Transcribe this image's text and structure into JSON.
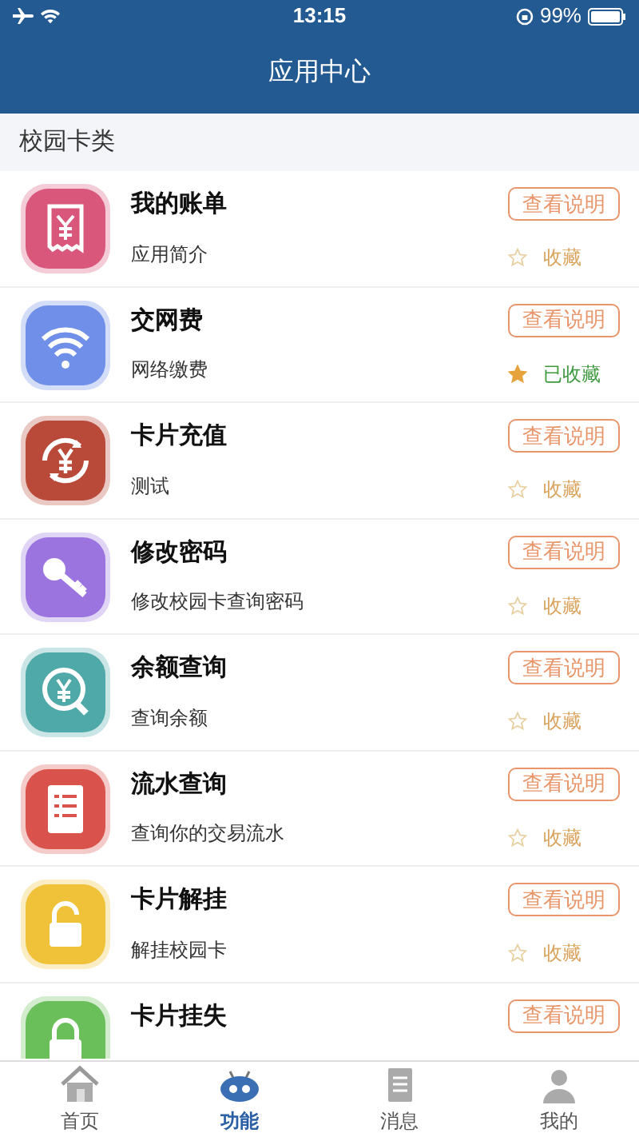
{
  "status_bar": {
    "time": "13:15",
    "battery": "99%"
  },
  "nav_bar": {
    "title": "应用中心"
  },
  "section": {
    "title": "校园卡类"
  },
  "apps": [
    {
      "title": "我的账单",
      "subtitle": "应用简介",
      "button": "查看说明",
      "favorite": {
        "label": "收藏",
        "favorited": false
      },
      "color": "#d9577a"
    },
    {
      "title": "交网费",
      "subtitle": "网络缴费",
      "button": "查看说明",
      "favorite": {
        "label": "已收藏",
        "favorited": true
      },
      "color": "#6f8fe8"
    },
    {
      "title": "卡片充值",
      "subtitle": "测试",
      "button": "查看说明",
      "favorite": {
        "label": "收藏",
        "favorited": false
      },
      "color": "#b94a3a"
    },
    {
      "title": "修改密码",
      "subtitle": "修改校园卡查询密码",
      "button": "查看说明",
      "favorite": {
        "label": "收藏",
        "favorited": false
      },
      "color": "#9b74e0"
    },
    {
      "title": "余额查询",
      "subtitle": "查询余额",
      "button": "查看说明",
      "favorite": {
        "label": "收藏",
        "favorited": false
      },
      "color": "#4fa9a9"
    },
    {
      "title": "流水查询",
      "subtitle": "查询你的交易流水",
      "button": "查看说明",
      "favorite": {
        "label": "收藏",
        "favorited": false
      },
      "color": "#d9524b"
    },
    {
      "title": "卡片解挂",
      "subtitle": "解挂校园卡",
      "button": "查看说明",
      "favorite": {
        "label": "收藏",
        "favorited": false
      },
      "color": "#f0c23a"
    },
    {
      "title": "卡片挂失",
      "button": "查看说明",
      "color": "#6bbf5b"
    }
  ],
  "tab_bar": [
    {
      "label": "首页",
      "selected": false
    },
    {
      "label": "功能",
      "selected": true
    },
    {
      "label": "消息",
      "selected": false
    },
    {
      "label": "我的",
      "selected": false
    }
  ]
}
